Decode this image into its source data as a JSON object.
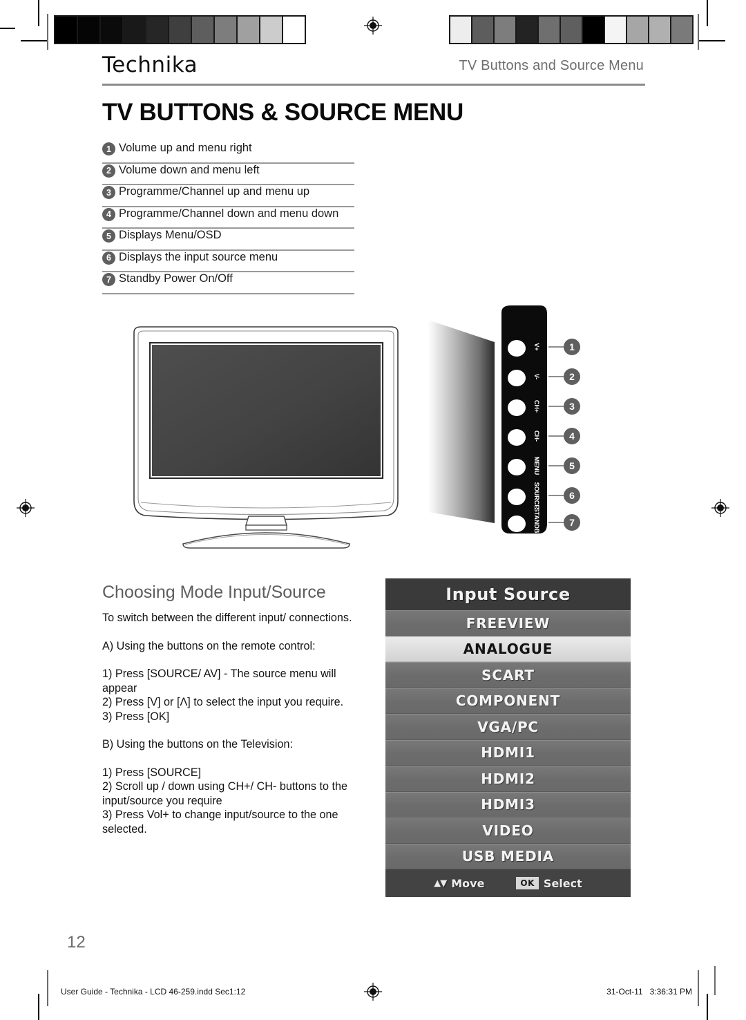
{
  "header": {
    "brand": "Technika",
    "running_head": "TV Buttons and Source Menu",
    "title": "TV BUTTONS & SOURCE MENU"
  },
  "legend": {
    "items": [
      {
        "num": "1",
        "label": "Volume up and menu right"
      },
      {
        "num": "2",
        "label": "Volume down and menu left"
      },
      {
        "num": "3",
        "label": "Programme/Channel up and menu up"
      },
      {
        "num": "4",
        "label": "Programme/Channel down and menu down"
      },
      {
        "num": "5",
        "label": "Displays Menu/OSD"
      },
      {
        "num": "6",
        "label": "Displays the input source menu"
      },
      {
        "num": "7",
        "label": "Standby Power On/Off"
      }
    ]
  },
  "tv_panel": {
    "buttons": [
      {
        "callout": "1",
        "label": "V+"
      },
      {
        "callout": "2",
        "label": "V-"
      },
      {
        "callout": "3",
        "label": "CH+"
      },
      {
        "callout": "4",
        "label": "CH-"
      },
      {
        "callout": "5",
        "label": "MENU"
      },
      {
        "callout": "6",
        "label": "SOURCE"
      },
      {
        "callout": "7",
        "label": "STANDBY"
      }
    ]
  },
  "section": {
    "title": "Choosing Mode Input/Source",
    "intro": "To switch between the different input/ connections.",
    "part_a_heading": "A) Using the buttons on the remote control:",
    "part_a_steps": "1) Press [SOURCE/ AV] - The source menu will appear\n2) Press [V] or [Λ] to select the input you require.\n3) Press [OK]",
    "part_b_heading": "B) Using the buttons on the Television:",
    "part_b_steps": "1) Press [SOURCE]\n2) Scroll up / down using CH+/ CH- buttons to the input/source you require\n3) Press Vol+ to change input/source to the one selected."
  },
  "osd": {
    "title": "Input Source",
    "items": [
      {
        "label": "FREEVIEW",
        "selected": false
      },
      {
        "label": "ANALOGUE",
        "selected": true
      },
      {
        "label": "SCART",
        "selected": false
      },
      {
        "label": "COMPONENT",
        "selected": false
      },
      {
        "label": "VGA/PC",
        "selected": false
      },
      {
        "label": "HDMI1",
        "selected": false
      },
      {
        "label": "HDMI2",
        "selected": false
      },
      {
        "label": "HDMI3",
        "selected": false
      },
      {
        "label": "VIDEO",
        "selected": false
      },
      {
        "label": "USB MEDIA",
        "selected": false
      }
    ],
    "footer": {
      "move_arrows": "▲▼",
      "move_label": "Move",
      "ok_badge": "OK",
      "select_label": "Select"
    }
  },
  "page_footer": {
    "folio": "12",
    "file_info": "User Guide - Technika - LCD 46-259.indd   Sec1:12",
    "timestamp": "31-Oct-11   3:36:31 PM"
  },
  "calibration": {
    "left_strip": [
      "#000000",
      "#050505",
      "#0b0b0b",
      "#191919",
      "#262626",
      "#3f3f3f",
      "#5e5e5e",
      "#7d7d7d",
      "#a0a0a0",
      "#cccccc",
      "#ffffff"
    ],
    "right_strip": [
      "#ededed",
      "#5d5d5d",
      "#7d7d7d",
      "#232323",
      "#6f6f6f",
      "#5f5f5f",
      "#000000",
      "#f4f4f4",
      "#a6a6a6",
      "#b0b0b0",
      "#7a7a7a"
    ]
  }
}
